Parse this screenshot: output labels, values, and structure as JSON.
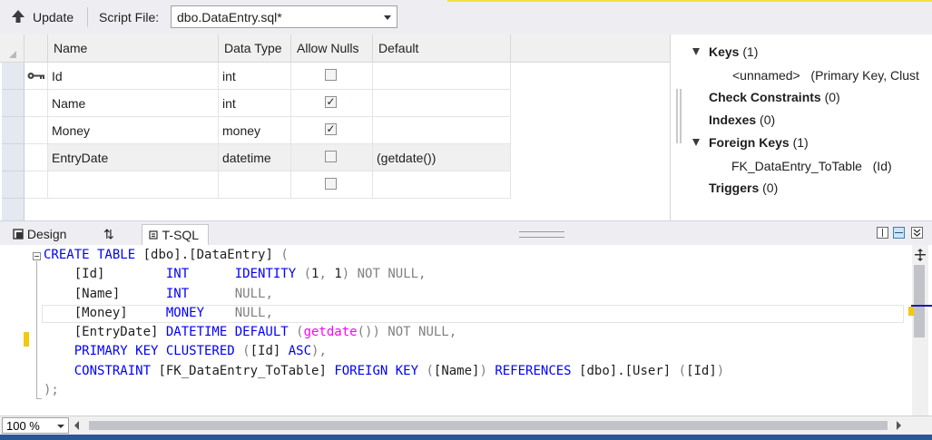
{
  "toolbar": {
    "update_label": "Update",
    "script_file_label": "Script File:",
    "script_file_value": "dbo.DataEntry.sql*"
  },
  "grid": {
    "headers": [
      "Name",
      "Data Type",
      "Allow Nulls",
      "Default"
    ],
    "rows": [
      {
        "name": "Id",
        "type": "int",
        "nulls": "",
        "default": ""
      },
      {
        "name": "Name",
        "type": "int",
        "nulls": "✓",
        "default": ""
      },
      {
        "name": "Money",
        "type": "money",
        "nulls": "✓",
        "default": ""
      },
      {
        "name": "EntryDate",
        "type": "datetime",
        "nulls": "",
        "default": "(getdate())"
      },
      {
        "name": "",
        "type": "",
        "nulls": "",
        "default": ""
      }
    ]
  },
  "properties": {
    "keys_label": "Keys",
    "keys_count": "(1)",
    "key_item_name": "<unnamed>",
    "key_item_desc": "(Primary Key, Clust",
    "check_label": "Check Constraints",
    "check_count": "(0)",
    "indexes_label": "Indexes",
    "indexes_count": "(0)",
    "fk_label": "Foreign Keys",
    "fk_count": "(1)",
    "fk_item_name": "FK_DataEntry_ToTable",
    "fk_item_desc": "(Id)",
    "triggers_label": "Triggers",
    "triggers_count": "(0)"
  },
  "tabs": {
    "design": "Design",
    "swap": "⇅",
    "tsql": "T-SQL"
  },
  "sql": {
    "l1_a": "CREATE TABLE",
    "l1_b": " [dbo].[DataEntry] ",
    "l1_c": "(",
    "l2_a": "    [Id]        ",
    "l2_b": "INT",
    "l2_c": "      ",
    "l2_d": "IDENTITY",
    "l2_e": " (",
    "l2_f": "1",
    "l2_g": ", ",
    "l2_h": "1",
    "l2_i": ") NOT NULL,",
    "l3_a": "    [Name]      ",
    "l3_b": "INT",
    "l3_c": "      ",
    "l3_d": "NULL,",
    "l4_a": "    [Money]     ",
    "l4_b": "MONEY",
    "l4_c": "    ",
    "l4_d": "NULL,",
    "l5_a": "    [EntryDate] ",
    "l5_b": "DATETIME DEFAULT",
    "l5_c": " (",
    "l5_d": "getdate",
    "l5_e": "()) NOT NULL,",
    "l6_a": "    ",
    "l6_b": "PRIMARY KEY CLUSTERED",
    "l6_c": " (",
    "l6_d": "[Id] ",
    "l6_e": "ASC",
    "l6_f": "),",
    "l7_a": "    ",
    "l7_b": "CONSTRAINT",
    "l7_c": " [FK_DataEntry_ToTable] ",
    "l7_d": "FOREIGN KEY",
    "l7_e": " (",
    "l7_f": "[Name]",
    "l7_g": ") ",
    "l7_h": "REFERENCES",
    "l7_i": " [dbo].[User] ",
    "l7_j": "(",
    "l7_k": "[Id]",
    "l7_l": ")",
    "l8_a": ");"
  },
  "status": {
    "zoom": "100 %"
  }
}
